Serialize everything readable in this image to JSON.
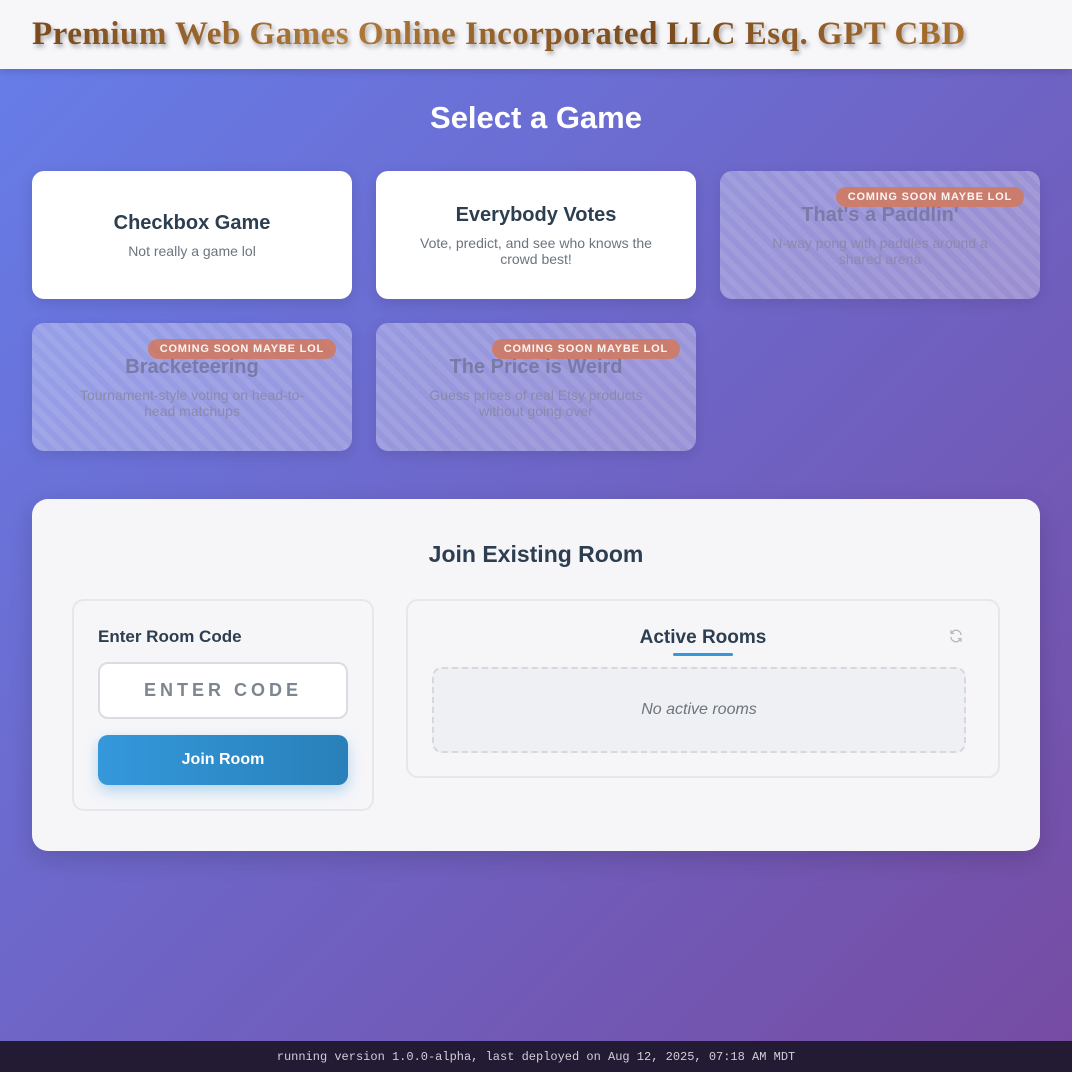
{
  "header": {
    "site_title": "Premium Web Games Online Incorporated LLC Esq. GPT CBD"
  },
  "games_section": {
    "heading": "Select a Game"
  },
  "games": [
    {
      "title": "Checkbox Game",
      "description": "Not really a game lol",
      "available": true
    },
    {
      "title": "Everybody Votes",
      "description": "Vote, predict, and see who knows the crowd best!",
      "available": true
    },
    {
      "title": "That's a Paddlin'",
      "description": "N-way pong with paddles around a shared arena",
      "available": false,
      "badge": "COMING SOON MAYBE LOL"
    },
    {
      "title": "Bracketeering",
      "description": "Tournament-style voting on head-to-head matchups",
      "available": false,
      "badge": "COMING SOON MAYBE LOL"
    },
    {
      "title": "The Price is Weird",
      "description": "Guess prices of real Etsy products without going over",
      "available": false,
      "badge": "COMING SOON MAYBE LOL"
    }
  ],
  "join": {
    "title": "Join Existing Room",
    "code_label": "Enter Room Code",
    "code_placeholder": "ENTER CODE",
    "code_value": "",
    "join_button_label": "Join Room"
  },
  "active_rooms": {
    "title": "Active Rooms",
    "refresh_icon": "refresh-icon",
    "empty_text": "No active rooms"
  },
  "footer": {
    "version_text": "running version 1.0.0-alpha, last deployed on Aug 12, 2025, 07:18 AM MDT"
  },
  "colors": {
    "bg_gradient_start": "#667eea",
    "bg_gradient_end": "#764ba2",
    "accent_blue": "#3498db",
    "badge": "#d2785a",
    "text_dark": "#2c3e50",
    "footer_bg": "#231a33"
  }
}
